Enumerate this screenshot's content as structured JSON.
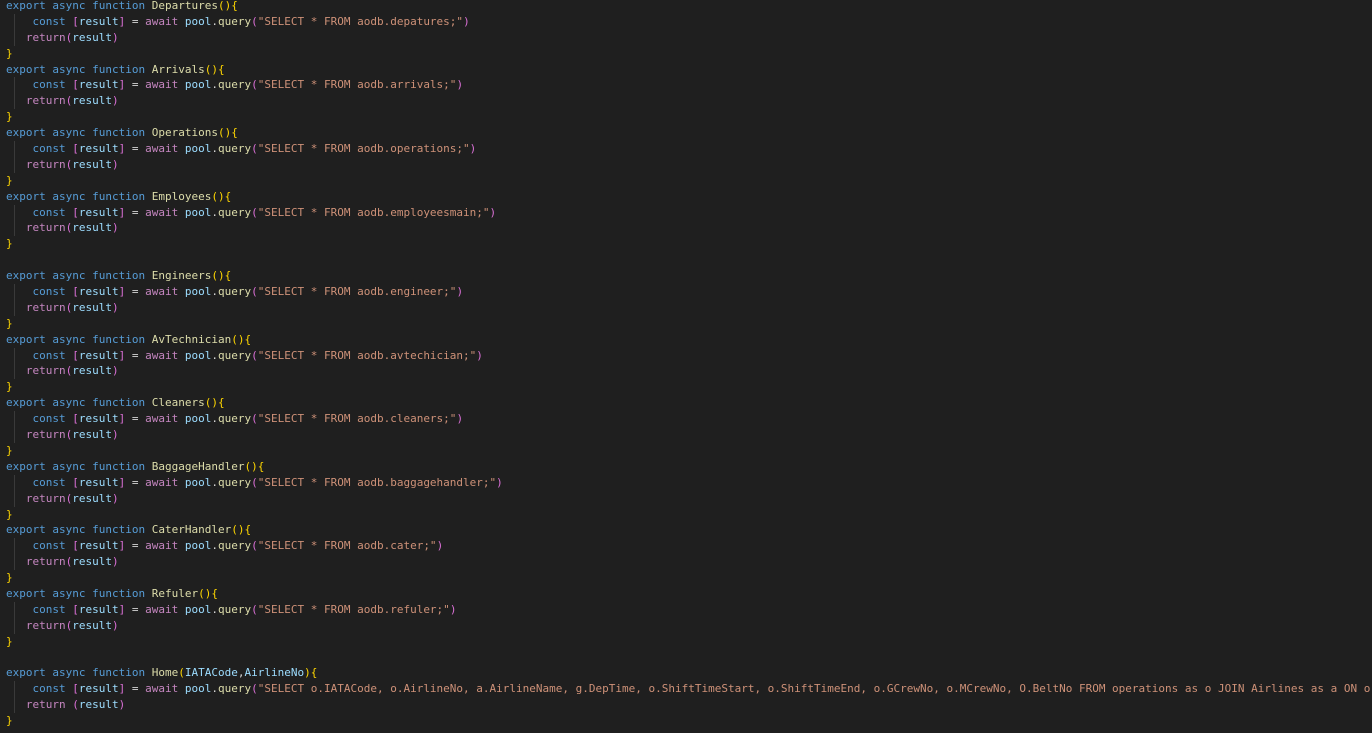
{
  "colors": {
    "background": "#1f1f1f",
    "keyword": "#569cd6",
    "control": "#c586c0",
    "function": "#dcdcaa",
    "variable": "#9cdcfe",
    "string": "#ce9178",
    "bracket_level1": "#ffd700",
    "bracket_level2": "#da70d6",
    "bracket_level3": "#179fff",
    "plain": "#d4d4d4"
  },
  "code_lines": [
    [
      [
        "kw",
        "export"
      ],
      [
        "pl",
        " "
      ],
      [
        "kw",
        "async"
      ],
      [
        "pl",
        " "
      ],
      [
        "kw",
        "function"
      ],
      [
        "pl",
        " "
      ],
      [
        "fn",
        "Departures"
      ],
      [
        "br1",
        "()"
      ],
      [
        "br1",
        "{"
      ]
    ],
    [
      [
        "pl",
        "    "
      ],
      [
        "kw",
        "const"
      ],
      [
        "pl",
        " "
      ],
      [
        "br2",
        "["
      ],
      [
        "var",
        "result"
      ],
      [
        "br2",
        "]"
      ],
      [
        "pl",
        " = "
      ],
      [
        "ctl",
        "await"
      ],
      [
        "pl",
        " "
      ],
      [
        "var",
        "pool"
      ],
      [
        "pl",
        "."
      ],
      [
        "fn",
        "query"
      ],
      [
        "br2",
        "("
      ],
      [
        "str",
        "\"SELECT * FROM aodb.depatures;\""
      ],
      [
        "br2",
        ")"
      ]
    ],
    [
      [
        "pl",
        "   "
      ],
      [
        "ctl",
        "return"
      ],
      [
        "br2",
        "("
      ],
      [
        "var",
        "result"
      ],
      [
        "br2",
        ")"
      ]
    ],
    [
      [
        "br1",
        "}"
      ]
    ],
    [
      [
        "kw",
        "export"
      ],
      [
        "pl",
        " "
      ],
      [
        "kw",
        "async"
      ],
      [
        "pl",
        " "
      ],
      [
        "kw",
        "function"
      ],
      [
        "pl",
        " "
      ],
      [
        "fn",
        "Arrivals"
      ],
      [
        "br1",
        "()"
      ],
      [
        "br1",
        "{"
      ]
    ],
    [
      [
        "pl",
        "    "
      ],
      [
        "kw",
        "const"
      ],
      [
        "pl",
        " "
      ],
      [
        "br2",
        "["
      ],
      [
        "var",
        "result"
      ],
      [
        "br2",
        "]"
      ],
      [
        "pl",
        " = "
      ],
      [
        "ctl",
        "await"
      ],
      [
        "pl",
        " "
      ],
      [
        "var",
        "pool"
      ],
      [
        "pl",
        "."
      ],
      [
        "fn",
        "query"
      ],
      [
        "br2",
        "("
      ],
      [
        "str",
        "\"SELECT * FROM aodb.arrivals;\""
      ],
      [
        "br2",
        ")"
      ]
    ],
    [
      [
        "pl",
        "   "
      ],
      [
        "ctl",
        "return"
      ],
      [
        "br2",
        "("
      ],
      [
        "var",
        "result"
      ],
      [
        "br2",
        ")"
      ]
    ],
    [
      [
        "br1",
        "}"
      ]
    ],
    [
      [
        "kw",
        "export"
      ],
      [
        "pl",
        " "
      ],
      [
        "kw",
        "async"
      ],
      [
        "pl",
        " "
      ],
      [
        "kw",
        "function"
      ],
      [
        "pl",
        " "
      ],
      [
        "fn",
        "Operations"
      ],
      [
        "br1",
        "()"
      ],
      [
        "br1",
        "{"
      ]
    ],
    [
      [
        "pl",
        "    "
      ],
      [
        "kw",
        "const"
      ],
      [
        "pl",
        " "
      ],
      [
        "br2",
        "["
      ],
      [
        "var",
        "result"
      ],
      [
        "br2",
        "]"
      ],
      [
        "pl",
        " = "
      ],
      [
        "ctl",
        "await"
      ],
      [
        "pl",
        " "
      ],
      [
        "var",
        "pool"
      ],
      [
        "pl",
        "."
      ],
      [
        "fn",
        "query"
      ],
      [
        "br2",
        "("
      ],
      [
        "str",
        "\"SELECT * FROM aodb.operations;\""
      ],
      [
        "br2",
        ")"
      ]
    ],
    [
      [
        "pl",
        "   "
      ],
      [
        "ctl",
        "return"
      ],
      [
        "br2",
        "("
      ],
      [
        "var",
        "result"
      ],
      [
        "br2",
        ")"
      ]
    ],
    [
      [
        "br1",
        "}"
      ]
    ],
    [
      [
        "kw",
        "export"
      ],
      [
        "pl",
        " "
      ],
      [
        "kw",
        "async"
      ],
      [
        "pl",
        " "
      ],
      [
        "kw",
        "function"
      ],
      [
        "pl",
        " "
      ],
      [
        "fn",
        "Employees"
      ],
      [
        "br1",
        "()"
      ],
      [
        "br1",
        "{"
      ]
    ],
    [
      [
        "pl",
        "    "
      ],
      [
        "kw",
        "const"
      ],
      [
        "pl",
        " "
      ],
      [
        "br2",
        "["
      ],
      [
        "var",
        "result"
      ],
      [
        "br2",
        "]"
      ],
      [
        "pl",
        " = "
      ],
      [
        "ctl",
        "await"
      ],
      [
        "pl",
        " "
      ],
      [
        "var",
        "pool"
      ],
      [
        "pl",
        "."
      ],
      [
        "fn",
        "query"
      ],
      [
        "br2",
        "("
      ],
      [
        "str",
        "\"SELECT * FROM aodb.employeesmain;\""
      ],
      [
        "br2",
        ")"
      ]
    ],
    [
      [
        "pl",
        "   "
      ],
      [
        "ctl",
        "return"
      ],
      [
        "br2",
        "("
      ],
      [
        "var",
        "result"
      ],
      [
        "br2",
        ")"
      ]
    ],
    [
      [
        "br1",
        "}"
      ]
    ],
    [],
    [
      [
        "kw",
        "export"
      ],
      [
        "pl",
        " "
      ],
      [
        "kw",
        "async"
      ],
      [
        "pl",
        " "
      ],
      [
        "kw",
        "function"
      ],
      [
        "pl",
        " "
      ],
      [
        "fn",
        "Engineers"
      ],
      [
        "br1",
        "()"
      ],
      [
        "br1",
        "{"
      ]
    ],
    [
      [
        "pl",
        "    "
      ],
      [
        "kw",
        "const"
      ],
      [
        "pl",
        " "
      ],
      [
        "br2",
        "["
      ],
      [
        "var",
        "result"
      ],
      [
        "br2",
        "]"
      ],
      [
        "pl",
        " = "
      ],
      [
        "ctl",
        "await"
      ],
      [
        "pl",
        " "
      ],
      [
        "var",
        "pool"
      ],
      [
        "pl",
        "."
      ],
      [
        "fn",
        "query"
      ],
      [
        "br2",
        "("
      ],
      [
        "str",
        "\"SELECT * FROM aodb.engineer;\""
      ],
      [
        "br2",
        ")"
      ]
    ],
    [
      [
        "pl",
        "   "
      ],
      [
        "ctl",
        "return"
      ],
      [
        "br2",
        "("
      ],
      [
        "var",
        "result"
      ],
      [
        "br2",
        ")"
      ]
    ],
    [
      [
        "br1",
        "}"
      ]
    ],
    [
      [
        "kw",
        "export"
      ],
      [
        "pl",
        " "
      ],
      [
        "kw",
        "async"
      ],
      [
        "pl",
        " "
      ],
      [
        "kw",
        "function"
      ],
      [
        "pl",
        " "
      ],
      [
        "fn",
        "AvTechnician"
      ],
      [
        "br1",
        "()"
      ],
      [
        "br1",
        "{"
      ]
    ],
    [
      [
        "pl",
        "    "
      ],
      [
        "kw",
        "const"
      ],
      [
        "pl",
        " "
      ],
      [
        "br2",
        "["
      ],
      [
        "var",
        "result"
      ],
      [
        "br2",
        "]"
      ],
      [
        "pl",
        " = "
      ],
      [
        "ctl",
        "await"
      ],
      [
        "pl",
        " "
      ],
      [
        "var",
        "pool"
      ],
      [
        "pl",
        "."
      ],
      [
        "fn",
        "query"
      ],
      [
        "br2",
        "("
      ],
      [
        "str",
        "\"SELECT * FROM aodb.avtechician;\""
      ],
      [
        "br2",
        ")"
      ]
    ],
    [
      [
        "pl",
        "   "
      ],
      [
        "ctl",
        "return"
      ],
      [
        "br2",
        "("
      ],
      [
        "var",
        "result"
      ],
      [
        "br2",
        ")"
      ]
    ],
    [
      [
        "br1",
        "}"
      ]
    ],
    [
      [
        "kw",
        "export"
      ],
      [
        "pl",
        " "
      ],
      [
        "kw",
        "async"
      ],
      [
        "pl",
        " "
      ],
      [
        "kw",
        "function"
      ],
      [
        "pl",
        " "
      ],
      [
        "fn",
        "Cleaners"
      ],
      [
        "br1",
        "()"
      ],
      [
        "br1",
        "{"
      ]
    ],
    [
      [
        "pl",
        "    "
      ],
      [
        "kw",
        "const"
      ],
      [
        "pl",
        " "
      ],
      [
        "br2",
        "["
      ],
      [
        "var",
        "result"
      ],
      [
        "br2",
        "]"
      ],
      [
        "pl",
        " = "
      ],
      [
        "ctl",
        "await"
      ],
      [
        "pl",
        " "
      ],
      [
        "var",
        "pool"
      ],
      [
        "pl",
        "."
      ],
      [
        "fn",
        "query"
      ],
      [
        "br2",
        "("
      ],
      [
        "str",
        "\"SELECT * FROM aodb.cleaners;\""
      ],
      [
        "br2",
        ")"
      ]
    ],
    [
      [
        "pl",
        "   "
      ],
      [
        "ctl",
        "return"
      ],
      [
        "br2",
        "("
      ],
      [
        "var",
        "result"
      ],
      [
        "br2",
        ")"
      ]
    ],
    [
      [
        "br1",
        "}"
      ]
    ],
    [
      [
        "kw",
        "export"
      ],
      [
        "pl",
        " "
      ],
      [
        "kw",
        "async"
      ],
      [
        "pl",
        " "
      ],
      [
        "kw",
        "function"
      ],
      [
        "pl",
        " "
      ],
      [
        "fn",
        "BaggageHandler"
      ],
      [
        "br1",
        "()"
      ],
      [
        "br1",
        "{"
      ]
    ],
    [
      [
        "pl",
        "    "
      ],
      [
        "kw",
        "const"
      ],
      [
        "pl",
        " "
      ],
      [
        "br2",
        "["
      ],
      [
        "var",
        "result"
      ],
      [
        "br2",
        "]"
      ],
      [
        "pl",
        " = "
      ],
      [
        "ctl",
        "await"
      ],
      [
        "pl",
        " "
      ],
      [
        "var",
        "pool"
      ],
      [
        "pl",
        "."
      ],
      [
        "fn",
        "query"
      ],
      [
        "br2",
        "("
      ],
      [
        "str",
        "\"SELECT * FROM aodb.baggagehandler;\""
      ],
      [
        "br2",
        ")"
      ]
    ],
    [
      [
        "pl",
        "   "
      ],
      [
        "ctl",
        "return"
      ],
      [
        "br2",
        "("
      ],
      [
        "var",
        "result"
      ],
      [
        "br2",
        ")"
      ]
    ],
    [
      [
        "br1",
        "}"
      ]
    ],
    [
      [
        "kw",
        "export"
      ],
      [
        "pl",
        " "
      ],
      [
        "kw",
        "async"
      ],
      [
        "pl",
        " "
      ],
      [
        "kw",
        "function"
      ],
      [
        "pl",
        " "
      ],
      [
        "fn",
        "CaterHandler"
      ],
      [
        "br1",
        "()"
      ],
      [
        "br1",
        "{"
      ]
    ],
    [
      [
        "pl",
        "    "
      ],
      [
        "kw",
        "const"
      ],
      [
        "pl",
        " "
      ],
      [
        "br2",
        "["
      ],
      [
        "var",
        "result"
      ],
      [
        "br2",
        "]"
      ],
      [
        "pl",
        " = "
      ],
      [
        "ctl",
        "await"
      ],
      [
        "pl",
        " "
      ],
      [
        "var",
        "pool"
      ],
      [
        "pl",
        "."
      ],
      [
        "fn",
        "query"
      ],
      [
        "br2",
        "("
      ],
      [
        "str",
        "\"SELECT * FROM aodb.cater;\""
      ],
      [
        "br2",
        ")"
      ]
    ],
    [
      [
        "pl",
        "   "
      ],
      [
        "ctl",
        "return"
      ],
      [
        "br2",
        "("
      ],
      [
        "var",
        "result"
      ],
      [
        "br2",
        ")"
      ]
    ],
    [
      [
        "br1",
        "}"
      ]
    ],
    [
      [
        "kw",
        "export"
      ],
      [
        "pl",
        " "
      ],
      [
        "kw",
        "async"
      ],
      [
        "pl",
        " "
      ],
      [
        "kw",
        "function"
      ],
      [
        "pl",
        " "
      ],
      [
        "fn",
        "Refuler"
      ],
      [
        "br1",
        "()"
      ],
      [
        "br1",
        "{"
      ]
    ],
    [
      [
        "pl",
        "    "
      ],
      [
        "kw",
        "const"
      ],
      [
        "pl",
        " "
      ],
      [
        "br2",
        "["
      ],
      [
        "var",
        "result"
      ],
      [
        "br2",
        "]"
      ],
      [
        "pl",
        " = "
      ],
      [
        "ctl",
        "await"
      ],
      [
        "pl",
        " "
      ],
      [
        "var",
        "pool"
      ],
      [
        "pl",
        "."
      ],
      [
        "fn",
        "query"
      ],
      [
        "br2",
        "("
      ],
      [
        "str",
        "\"SELECT * FROM aodb.refuler;\""
      ],
      [
        "br2",
        ")"
      ]
    ],
    [
      [
        "pl",
        "   "
      ],
      [
        "ctl",
        "return"
      ],
      [
        "br2",
        "("
      ],
      [
        "var",
        "result"
      ],
      [
        "br2",
        ")"
      ]
    ],
    [
      [
        "br1",
        "}"
      ]
    ],
    [],
    [
      [
        "kw",
        "export"
      ],
      [
        "pl",
        " "
      ],
      [
        "kw",
        "async"
      ],
      [
        "pl",
        " "
      ],
      [
        "kw",
        "function"
      ],
      [
        "pl",
        " "
      ],
      [
        "fn",
        "Home"
      ],
      [
        "br1",
        "("
      ],
      [
        "var",
        "IATACode"
      ],
      [
        "pl",
        ","
      ],
      [
        "var",
        "AirlineNo"
      ],
      [
        "br1",
        ")"
      ],
      [
        "br1",
        "{"
      ]
    ],
    [
      [
        "pl",
        "    "
      ],
      [
        "kw",
        "const"
      ],
      [
        "pl",
        " "
      ],
      [
        "br2",
        "["
      ],
      [
        "var",
        "result"
      ],
      [
        "br2",
        "]"
      ],
      [
        "pl",
        " = "
      ],
      [
        "ctl",
        "await"
      ],
      [
        "pl",
        " "
      ],
      [
        "var",
        "pool"
      ],
      [
        "pl",
        "."
      ],
      [
        "fn",
        "query"
      ],
      [
        "br2",
        "("
      ],
      [
        "str",
        "\"SELECT o.IATACode, o.AirlineNo, a.AirlineName, g.DepTime, o.ShiftTimeStart, o.ShiftTimeEnd, o.GCrewNo, o.MCrewNo, O.BeltNo FROM operations as o JOIN Airlines as a ON o.IATACo"
      ]
    ],
    [
      [
        "pl",
        "   "
      ],
      [
        "ctl",
        "return"
      ],
      [
        "pl",
        " "
      ],
      [
        "br2",
        "("
      ],
      [
        "var",
        "result"
      ],
      [
        "br2",
        ")"
      ]
    ],
    [
      [
        "br1",
        "}"
      ]
    ]
  ]
}
